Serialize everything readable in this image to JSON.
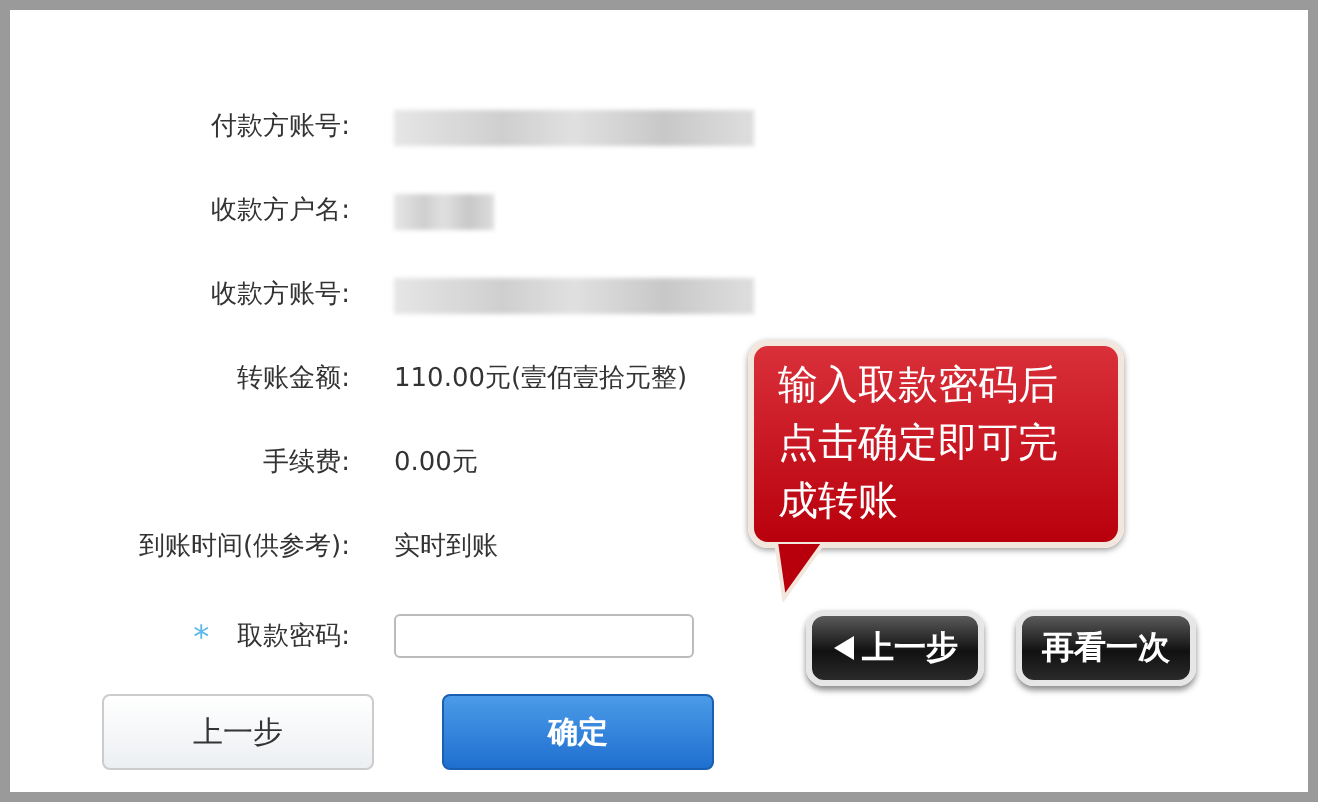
{
  "form": {
    "rows": [
      {
        "label": "付款方账号:",
        "kind": "redacted_long"
      },
      {
        "label": "收款方户名:",
        "kind": "redacted_short"
      },
      {
        "label": "收款方账号:",
        "kind": "redacted_long"
      },
      {
        "label": "转账金额:",
        "kind": "text",
        "value": "110.00元(壹佰壹拾元整)"
      },
      {
        "label": "手续费:",
        "kind": "text",
        "value": "0.00元"
      },
      {
        "label": "到账时间(供参考):",
        "kind": "text",
        "value": "实时到账"
      }
    ],
    "password": {
      "marker": "*",
      "label": "取款密码:"
    },
    "buttons": [
      {
        "label": "上一步",
        "kind": "secondary"
      },
      {
        "label": "确定",
        "kind": "primary"
      }
    ]
  },
  "tip": {
    "text": "输入取款密码后点击确定即可完成转账",
    "buttons": [
      {
        "label": "上一步",
        "kind": "back"
      },
      {
        "label": "再看一次",
        "kind": "plain"
      }
    ]
  }
}
